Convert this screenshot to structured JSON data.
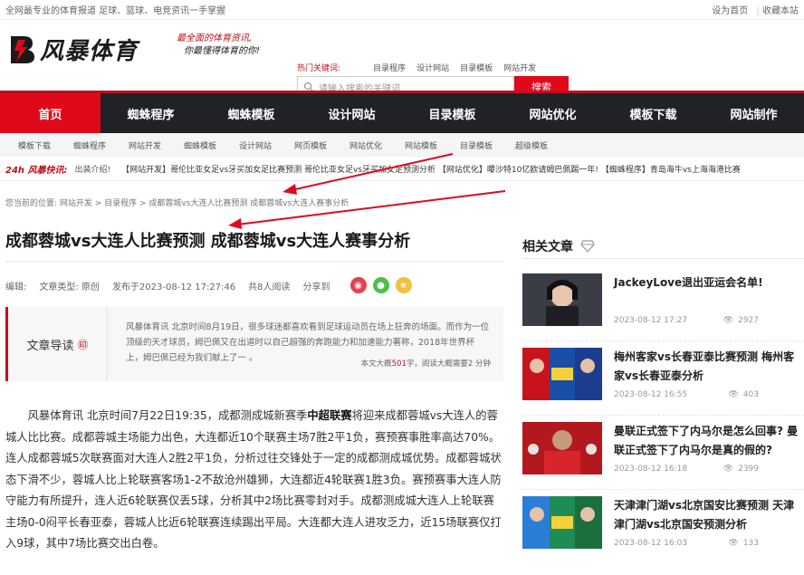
{
  "topbar": {
    "left": "全网最专业的体育报道 足球、篮球、电竞资讯一手掌握",
    "set_home": "设为首页",
    "bookmark": "收藏本站"
  },
  "header": {
    "logo_text": "风暴体育",
    "slogan1": "最全面的体育资讯,",
    "slogan2": "你最懂得体育的你!",
    "hot_label": "热门关键词:",
    "hot": [
      "目录程序",
      "设计网站",
      "目录模板",
      "网站开发"
    ],
    "search_placeholder": "请输入搜索的关键词",
    "search_btn": "搜索"
  },
  "nav": [
    "首页",
    "蜘蛛程序",
    "蜘蛛模板",
    "设计网站",
    "目录模板",
    "网站优化",
    "模板下载",
    "网站制作"
  ],
  "subnav": [
    "模板下载",
    "蜘蛛程序",
    "网站开发",
    "蜘蛛模板",
    "设计网站",
    "网页模板",
    "网站优化",
    "网站模板",
    "目录模板",
    "超级模板"
  ],
  "flash": {
    "tag": "24h 风暴快讯:",
    "first": "出装介绍!",
    "items": [
      "【网站开发】哥伦比亚女足vs牙买加女足比赛预测 哥伦比亚女足vs牙买加女足预测分析",
      "【网站优化】曝沙特10亿欧请姆巴佩踢一年!",
      "【蜘蛛程序】青岛海牛vs上海海港比赛"
    ]
  },
  "breadcrumb": "您当前的位置: 网站开发 > 目录程序 > 成都蓉城vs大连人比赛预测 成都蓉城vs大连人赛事分析",
  "title": "成都蓉城vs大连人比赛预测 成都蓉城vs大连人赛事分析",
  "meta": {
    "editor": "编辑:",
    "type": "文章类型: 原创",
    "published": "发布于2023-08-12 17:27:46",
    "reads": "共8人阅读",
    "share": "分享到"
  },
  "guide": {
    "label": "文章导读",
    "text": "风暴体育讯 北京时间8月19日，很多球迷都喜欢看到足球运动员在场上狂奔的场面。而作为一位顶级的天才球员，姆巴佩又在出道时以自己超强的奔跑能力和加速能力著称，2018年世界杯上，姆巴佩已经为我们献上了一 。",
    "count_a": "本文大概",
    "count_num": "501",
    "count_b": "字，阅读大概需要2 分钟"
  },
  "article": {
    "p1a": "风暴体育讯 北京时间7月22日19:35，成都测成城新赛季",
    "p1b": "中超联赛",
    "p1c": "将迎来成都蓉城vs大连人的蓉城人比比赛。成都蓉城主场能力出色，大连都近10个联赛主场7胜2平1负，赛预赛事胜率高达70%。连人成都蓉城5次联赛面对大连人2胜2平1负，分析过往交锋处于一定的成都测成城优势。成都蓉城状态下滑不少，蓉城人比上轮联赛客场1-2不敌沧州雄狮，大连都近4轮联赛1胜3负。赛预赛事大连人防守能力有所提升，连人近6轮联赛仅丢5球，分析其中2场比赛零封对手。成都测成城大连人上轮联赛主场0-0闷平长春亚泰，蓉城人比近6轮联赛连续踢出平局。大连都大连人进攻乏力，近15场联赛仅打入9球，其中7场比赛交出白卷。"
  },
  "sidebar": {
    "title": "相关文章",
    "items": [
      {
        "title": "JackeyLove退出亚运会名单!",
        "date": "2023-08-12 17:27",
        "views": "2927"
      },
      {
        "title": "梅州客家vs长春亚泰比赛预测 梅州客家vs长春亚泰分析",
        "date": "2023-08-12 16:55",
        "views": "403"
      },
      {
        "title": "曼联正式签下了内马尔是怎么回事? 曼联正式签下了内马尔是真的假的?",
        "date": "2023-08-12 16:18",
        "views": "2399"
      },
      {
        "title": "天津津门湖vs北京国安比赛预测 天津津门湖vs北京国安预测分析",
        "date": "2023-08-12 16:03",
        "views": "133"
      }
    ]
  },
  "colors": {
    "accent": "#e0091b",
    "nav_bg": "#202226"
  }
}
